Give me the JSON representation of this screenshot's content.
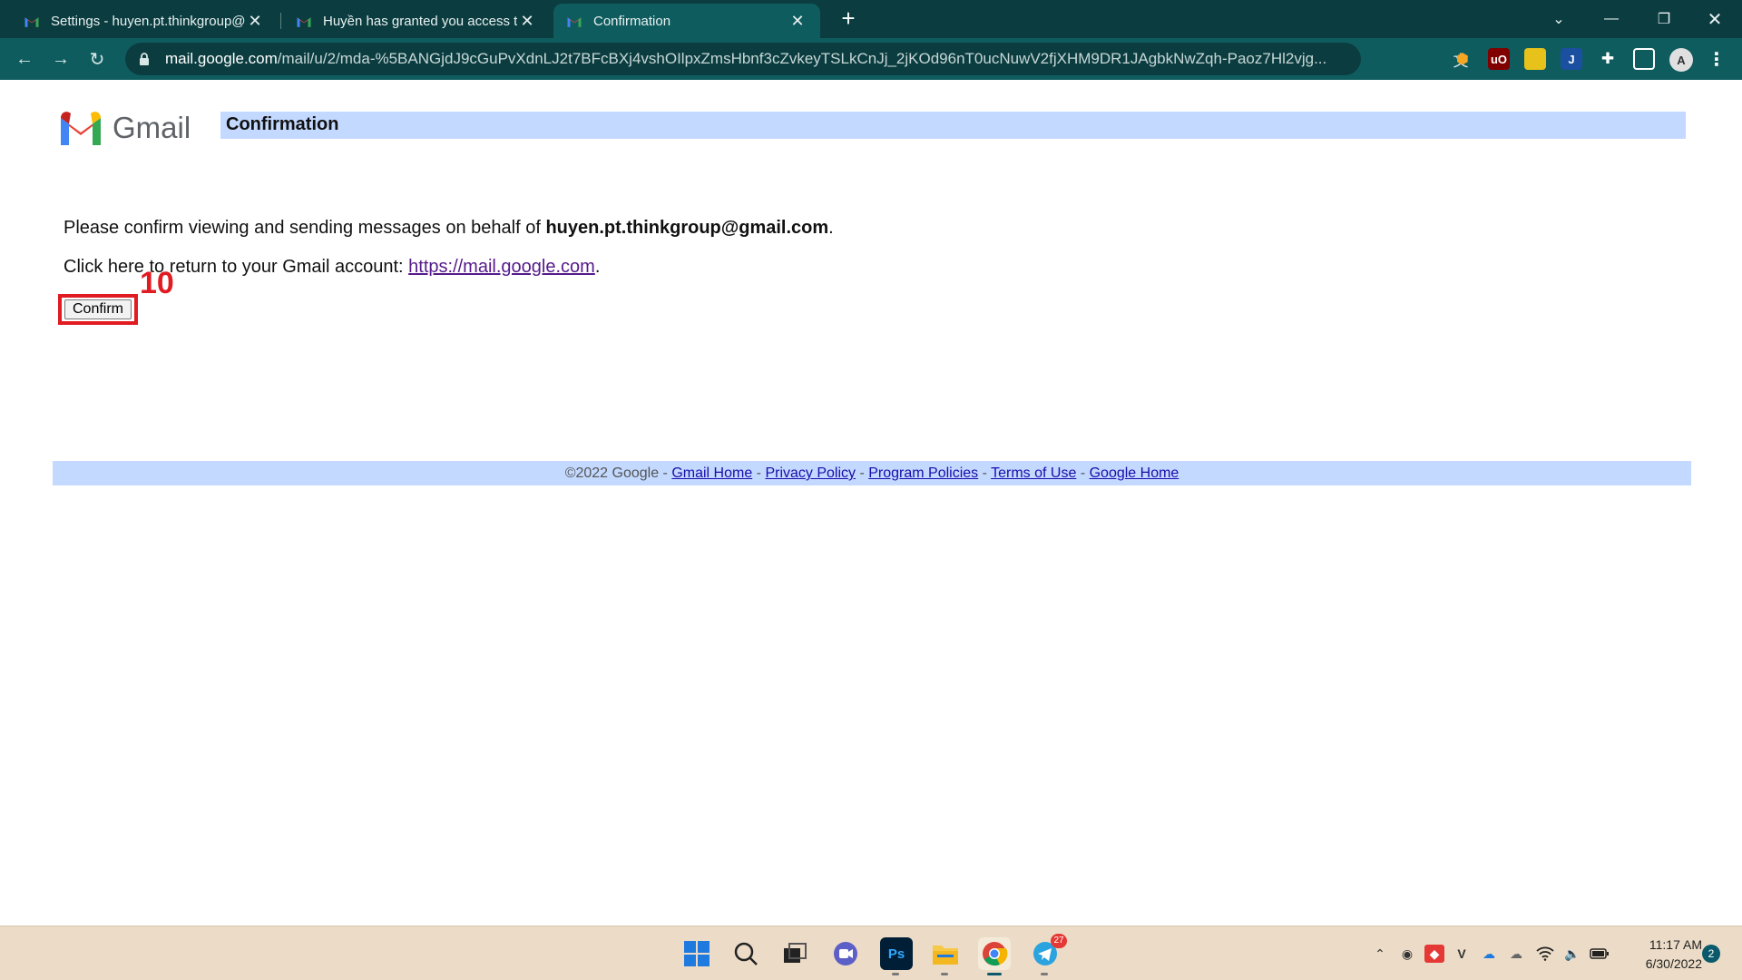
{
  "browser": {
    "tabs": [
      {
        "title": "Settings - huyen.pt.thinkgroup@gmail.com",
        "active": false
      },
      {
        "title": "Huyền has granted you access to their account",
        "active": false
      },
      {
        "title": "Confirmation",
        "active": true
      }
    ],
    "url_host": "mail.google.com",
    "url_path": "/mail/u/2/mda-%5BANGjdJ9cGuPvXdnLJ2t7BFcBXj4vshOIlpxZmsHbnf3cZvkeyTSLkCnJj_2jKOd96nT0ucNuwV2fjXHM9DR1JAgbkNwZqh-Paoz7Hl2vjg...",
    "accent": "#0f5c5f"
  },
  "page": {
    "logo_text": "Gmail",
    "title": "Confirmation",
    "line1_prefix": "Please confirm viewing and sending messages on behalf of ",
    "line1_email": "huyen.pt.thinkgroup@gmail.com",
    "line1_suffix": ".",
    "line2_prefix": "Click here to return to your Gmail account: ",
    "line2_link": "https://mail.google.com",
    "line2_suffix": ".",
    "confirm_label": "Confirm",
    "annotation": "10"
  },
  "footer": {
    "copyright": "©2022 Google",
    "links": [
      "Gmail Home",
      "Privacy Policy",
      "Program Policies",
      "Terms of Use",
      "Google Home"
    ],
    "separator": " - "
  },
  "taskbar": {
    "telegram_badge": "27",
    "time": "11:17 AM",
    "date": "6/30/2022",
    "notifications": "2"
  }
}
